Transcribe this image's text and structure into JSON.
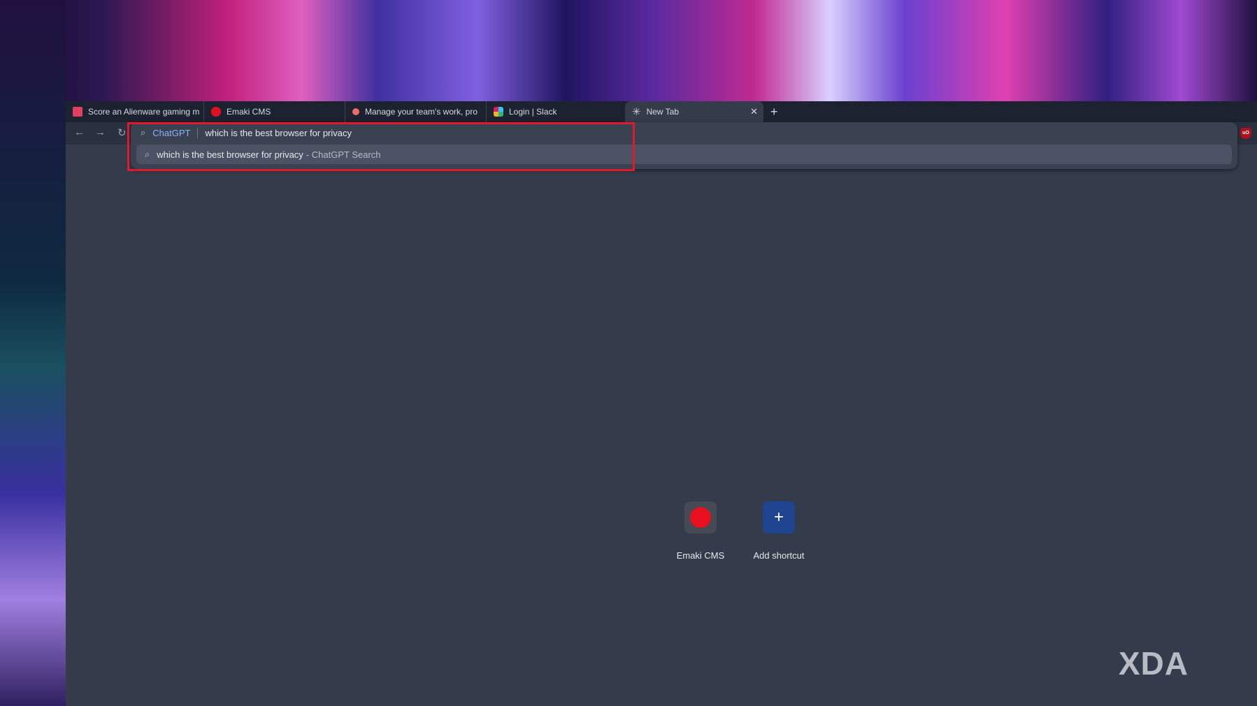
{
  "tabs": [
    {
      "title": "Score an Alienware gaming m",
      "favicon": "alienware-icon",
      "color": "#e04060"
    },
    {
      "title": "Emaki CMS",
      "favicon": "emaki-icon",
      "color": "#e01020"
    },
    {
      "title": "Manage your team's work, pro",
      "favicon": "asana-icon",
      "color": "#f06a6a"
    },
    {
      "title": "Login | Slack",
      "favicon": "slack-icon",
      "color": "#36c5f0"
    },
    {
      "title": "New Tab",
      "favicon": "chromium-icon",
      "active": true
    }
  ],
  "omnibox": {
    "engine": "ChatGPT",
    "query": "which is the best browser for privacy",
    "suggestion": "which is the best browser for privacy",
    "suggestion_suffix": "- ChatGPT Search"
  },
  "extension": {
    "label": "uO"
  },
  "shortcuts": [
    {
      "label": "Emaki CMS"
    },
    {
      "label": "Add shortcut",
      "icon": "+"
    }
  ],
  "watermark": "XDA",
  "colors": {
    "highlight": "#e0192c",
    "accent": "#8ab4f8"
  }
}
